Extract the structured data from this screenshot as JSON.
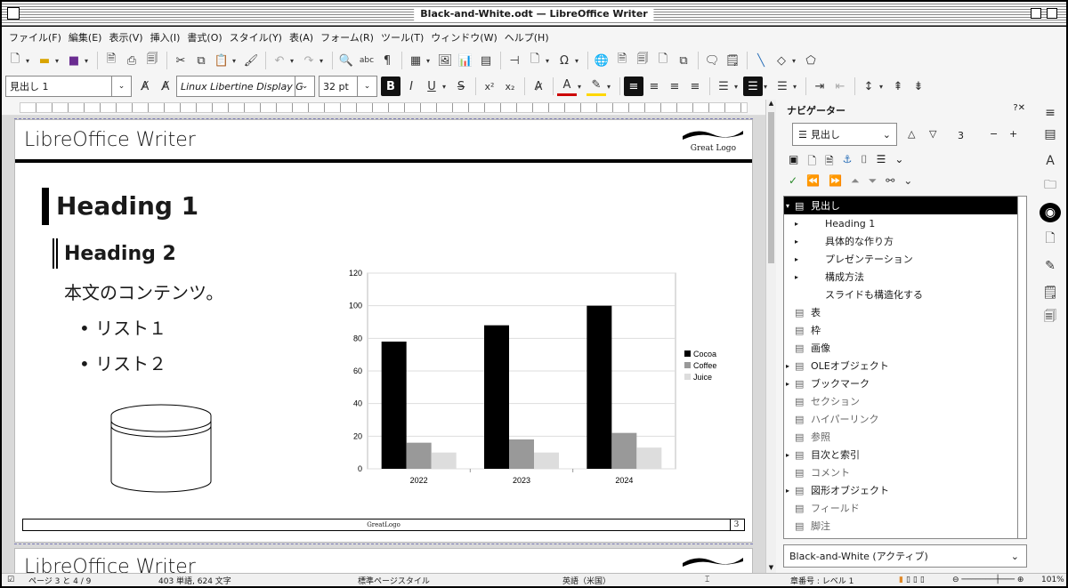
{
  "window": {
    "title": "Black-and-White.odt — LibreOffice Writer"
  },
  "menu": [
    "ファイル(F)",
    "編集(E)",
    "表示(V)",
    "挿入(I)",
    "書式(O)",
    "スタイル(Y)",
    "表(A)",
    "フォーム(R)",
    "ツール(T)",
    "ウィンドウ(W)",
    "ヘルプ(H)"
  ],
  "formatting": {
    "paragraph_style": "見出し 1",
    "font_name": "Linux Libertine Display G",
    "font_size": "32 pt"
  },
  "document": {
    "header_title": "LibreOffice Writer",
    "logo_text": "Great Logo",
    "heading1": "Heading 1",
    "heading2": "Heading 2",
    "body_text": "本文のコンテンツ。",
    "list": [
      "リスト１",
      "リスト２"
    ],
    "footer_text": "GreatLogo",
    "page_number": "3",
    "page2_title": "LibreOffice Writer"
  },
  "chart_data": {
    "type": "bar",
    "categories": [
      "2022",
      "2023",
      "2024"
    ],
    "series": [
      {
        "name": "Cocoa",
        "values": [
          78,
          88,
          100
        ],
        "color": "#000000"
      },
      {
        "name": "Coffee",
        "values": [
          16,
          18,
          22
        ],
        "color": "#999999"
      },
      {
        "name": "Juice",
        "values": [
          10,
          10,
          13
        ],
        "color": "#dddddd"
      }
    ],
    "ylim": [
      0,
      120
    ],
    "yticks": [
      0,
      20,
      40,
      60,
      80,
      100,
      120
    ],
    "grid": true,
    "legend": "right"
  },
  "navigator": {
    "title": "ナビゲーター",
    "close_label": "?✕",
    "category_combo": "見出し",
    "level_value": "3",
    "tree": [
      {
        "label": "見出し",
        "level": 0,
        "expanded": true,
        "selected": true
      },
      {
        "label": "Heading 1",
        "level": 1,
        "expander": true
      },
      {
        "label": "具体的な作り方",
        "level": 1,
        "expander": true
      },
      {
        "label": "プレゼンテーション",
        "level": 1,
        "expander": true
      },
      {
        "label": "構成方法",
        "level": 1,
        "expander": true
      },
      {
        "label": "スライドも構造化する",
        "level": 1,
        "expander": false
      },
      {
        "label": "表",
        "level": 0,
        "expander": false
      },
      {
        "label": "枠",
        "level": 0,
        "expander": false
      },
      {
        "label": "画像",
        "level": 0,
        "expander": false
      },
      {
        "label": "OLEオブジェクト",
        "level": 0,
        "expander": true
      },
      {
        "label": "ブックマーク",
        "level": 0,
        "expander": true
      },
      {
        "label": "セクション",
        "level": 0,
        "expander": false,
        "dim": true
      },
      {
        "label": "ハイパーリンク",
        "level": 0,
        "expander": false,
        "dim": true
      },
      {
        "label": "参照",
        "level": 0,
        "expander": false,
        "dim": true
      },
      {
        "label": "目次と索引",
        "level": 0,
        "expander": true
      },
      {
        "label": "コメント",
        "level": 0,
        "expander": false,
        "dim": true
      },
      {
        "label": "図形オブジェクト",
        "level": 0,
        "expander": true
      },
      {
        "label": "フィールド",
        "level": 0,
        "expander": false,
        "dim": true
      },
      {
        "label": "脚注",
        "level": 0,
        "expander": false,
        "dim": true
      }
    ],
    "document_combo": "Black-and-White (アクティブ)"
  },
  "status": {
    "page": "ページ 3 と 4 / 9",
    "words": "403 単語, 624 文字",
    "page_style": "標準ページスタイル",
    "language": "英語（米国）",
    "chapter": "章番号 : レベル 1",
    "zoom": "101%"
  }
}
